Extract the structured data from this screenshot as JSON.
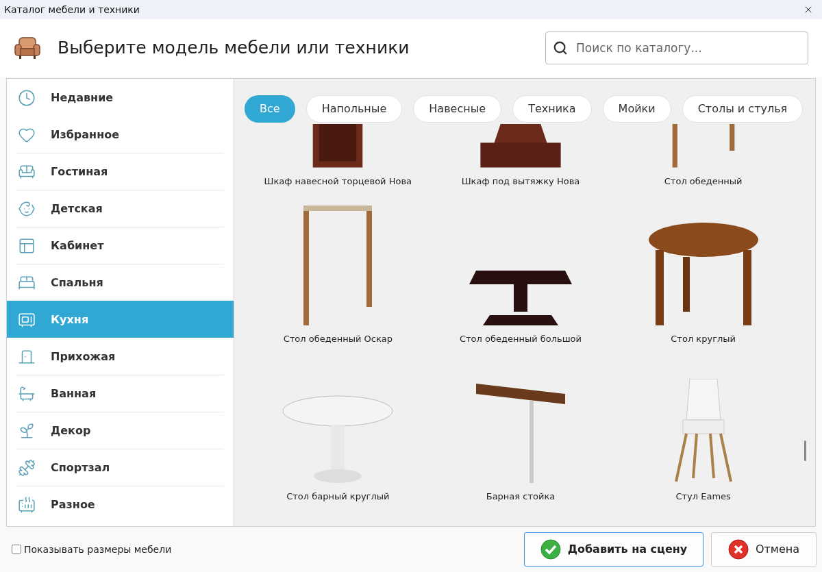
{
  "window": {
    "title": "Каталог мебели и техники"
  },
  "header": {
    "title": "Выберите модель мебели или техники",
    "search": {
      "placeholder": "Поиск по каталогу..."
    }
  },
  "sidebar": {
    "items": [
      {
        "label": "Недавние",
        "selected": false
      },
      {
        "label": "Избранное",
        "selected": false
      },
      {
        "label": "Гостиная",
        "selected": false
      },
      {
        "label": "Детская",
        "selected": false
      },
      {
        "label": "Кабинет",
        "selected": false
      },
      {
        "label": "Спальня",
        "selected": false
      },
      {
        "label": "Кухня",
        "selected": true
      },
      {
        "label": "Прихожая",
        "selected": false
      },
      {
        "label": "Ванная",
        "selected": false
      },
      {
        "label": "Декор",
        "selected": false
      },
      {
        "label": "Спортзал",
        "selected": false
      },
      {
        "label": "Разное",
        "selected": false
      }
    ]
  },
  "filters": [
    {
      "label": "Все",
      "selected": true
    },
    {
      "label": "Напольные",
      "selected": false
    },
    {
      "label": "Навесные",
      "selected": false
    },
    {
      "label": "Техника",
      "selected": false
    },
    {
      "label": "Мойки",
      "selected": false
    },
    {
      "label": "Столы и стулья",
      "selected": false
    }
  ],
  "products": [
    {
      "name": "Шкаф навесной торцевой Нова",
      "kind": "cabinet"
    },
    {
      "name": "Шкаф под вытяжку Нова",
      "kind": "hood-cabinet"
    },
    {
      "name": "Стол обеденный",
      "kind": "table"
    },
    {
      "name": "Стол обеденный Оскар",
      "kind": "table"
    },
    {
      "name": "Стол обеденный большой",
      "kind": "dark-table"
    },
    {
      "name": "Стол круглый",
      "kind": "round-table"
    },
    {
      "name": "Стол барный круглый",
      "kind": "tulip-table"
    },
    {
      "name": "Барная стойка",
      "kind": "bar-counter"
    },
    {
      "name": "Стул Eames",
      "kind": "chair"
    }
  ],
  "footer": {
    "show_sizes": {
      "label": "Показывать размеры мебели",
      "checked": false
    },
    "buttons": [
      {
        "label": "Добавить на сцену",
        "kind": "ok"
      },
      {
        "label": "Отмена",
        "kind": "cancel"
      }
    ]
  }
}
